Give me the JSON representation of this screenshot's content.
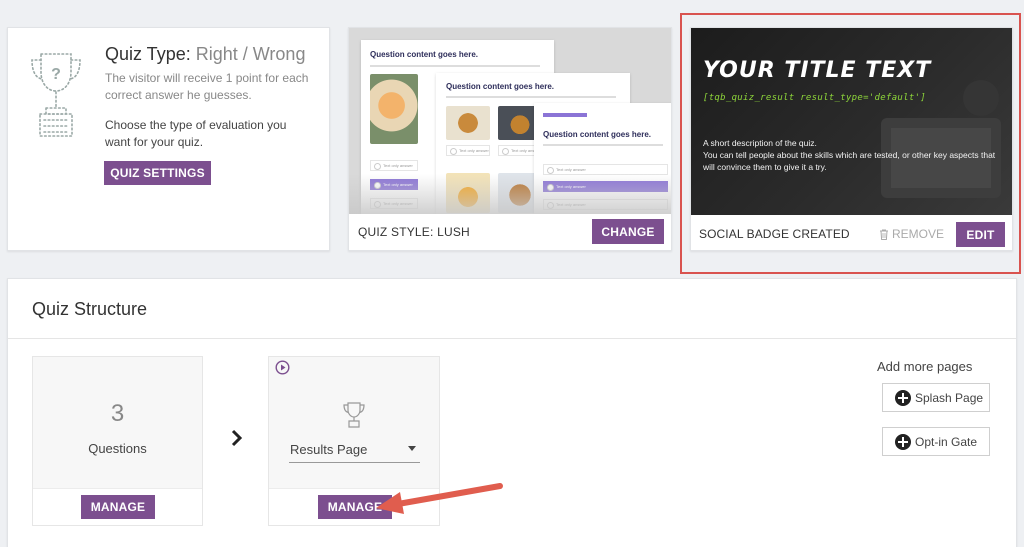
{
  "quiz_type": {
    "label": "Quiz Type:",
    "value": "Right / Wrong",
    "description": "The visitor will receive 1 point for each correct answer he guesses.",
    "choose_text": "Choose the type of evaluation you want for your quiz.",
    "settings_button": "QUIZ SETTINGS"
  },
  "quiz_style": {
    "preview_question": "Question content goes here.",
    "preview_answer": "Text only answer",
    "label": "QUIZ STYLE: LUSH",
    "change_button": "CHANGE"
  },
  "social_badge": {
    "title": "YOUR TITLE TEXT",
    "shortcode": "[tqb_quiz_result result_type='default']",
    "desc_line1": "A short description of the quiz.",
    "desc_line2": "You can tell people about the skills which are tested, or other key aspects that will convince them to give it a try.",
    "label": "SOCIAL BADGE CREATED",
    "remove_label": "REMOVE",
    "edit_button": "EDIT",
    "highlight_color": "#d9534f"
  },
  "quiz_structure": {
    "title": "Quiz Structure",
    "questions": {
      "count": "3",
      "label": "Questions",
      "manage_button": "MANAGE"
    },
    "results": {
      "select_value": "Results Page",
      "manage_button": "MANAGE"
    },
    "add_more": {
      "label": "Add more pages",
      "splash_page": "Splash Page",
      "opt_in_gate": "Opt-in Gate"
    }
  },
  "colors": {
    "accent": "#7c4f8f",
    "annotation": "#e05d4e",
    "preview_selected": "#8b74d6"
  }
}
